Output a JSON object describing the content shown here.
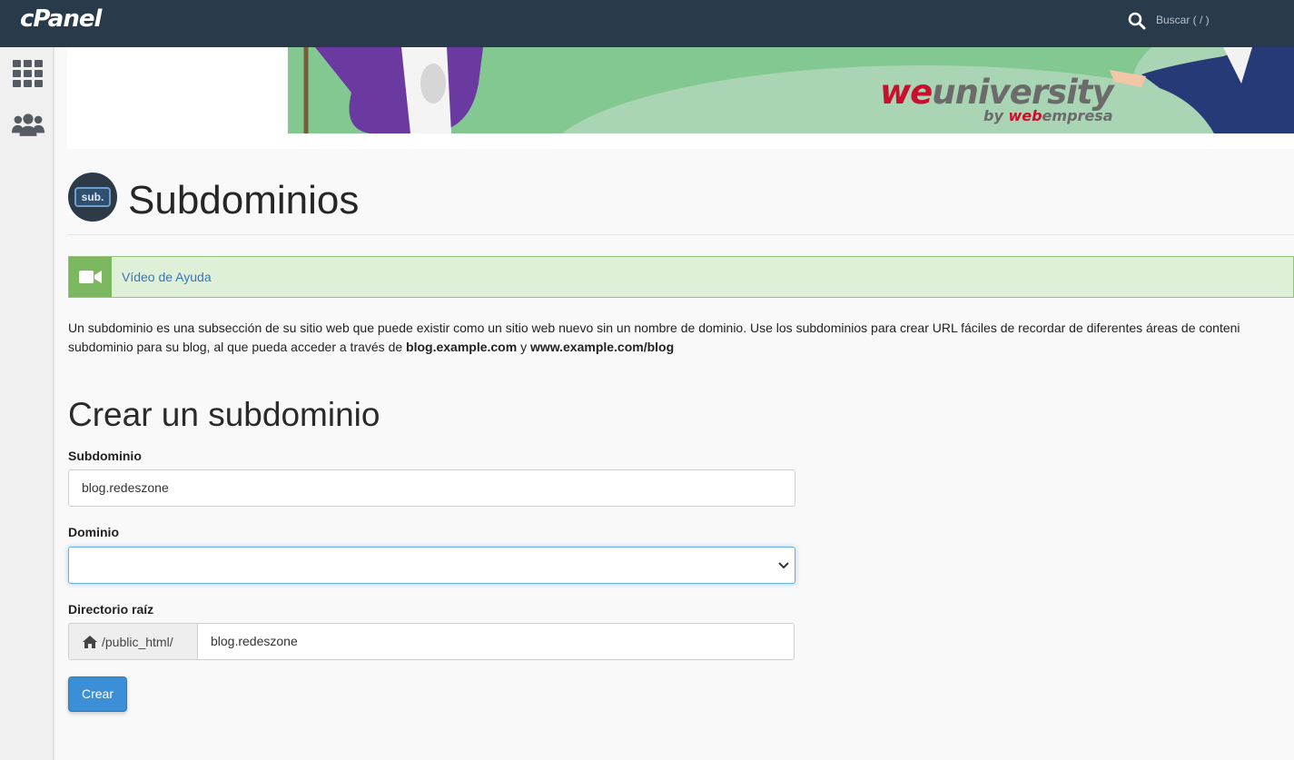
{
  "app": {
    "logo": "cPanel"
  },
  "search": {
    "placeholder": "Buscar ( / )"
  },
  "sidebar": {
    "items": [
      {
        "icon": "grid-icon"
      },
      {
        "icon": "users-icon"
      }
    ]
  },
  "banner": {
    "brand": "weuniversity",
    "by": "by webempresa",
    "colors": {
      "background": "#83c891",
      "brand_red": "#c8102e",
      "brand_gray": "#6b6b6b"
    }
  },
  "page": {
    "icon_text": "sub.",
    "title": "Subdominios"
  },
  "help": {
    "link_label": "Vídeo de Ayuda"
  },
  "description": {
    "line1": "Un subdominio es una subsección de su sitio web que puede existir como un sitio web nuevo sin un nombre de dominio. Use los subdominios para crear URL fáciles de recordar de diferentes áreas de conteni",
    "line2_prefix": "subdominio para su blog, al que pueda acceder a través de ",
    "example1": "blog.example.com",
    "joiner": " y ",
    "example2": "www.example.com/blog"
  },
  "form": {
    "title": "Crear un subdominio",
    "subdomain_label": "Subdominio",
    "subdomain_value": "blog.redeszone",
    "domain_label": "Dominio",
    "domain_value": "",
    "root_label": "Directorio raíz",
    "root_prefix": "/public_html/",
    "root_value": "blog.redeszone",
    "submit_label": "Crear"
  }
}
